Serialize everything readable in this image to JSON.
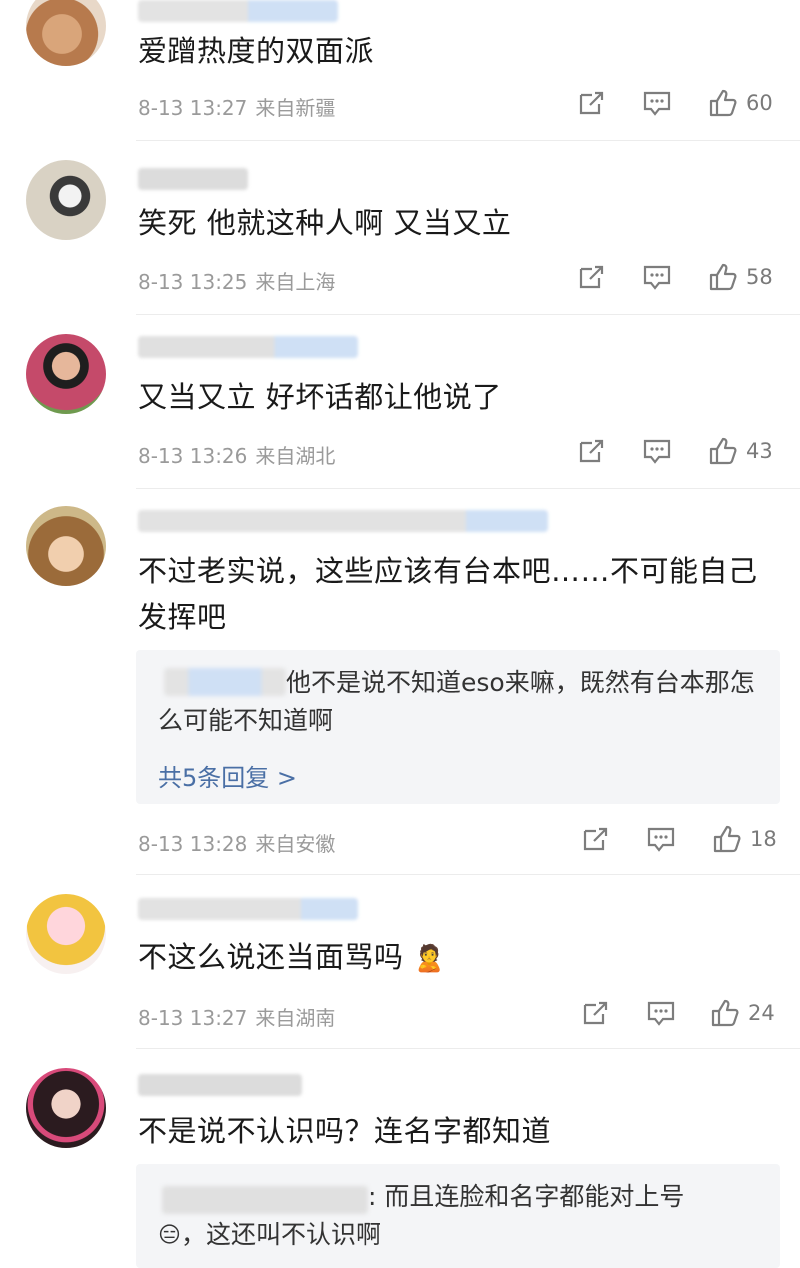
{
  "comments": [
    {
      "text": "爱蹭热度的双面派",
      "time": "8-13 13:27",
      "location": "来自新疆",
      "likes": "60"
    },
    {
      "text": "笑死 他就这种人啊 又当又立",
      "time": "8-13 13:25",
      "location": "来自上海",
      "likes": "58"
    },
    {
      "text": "又当又立 好坏话都让他说了",
      "time": "8-13 13:26",
      "location": "来自湖北",
      "likes": "43"
    },
    {
      "text": "不过老实说，这些应该有台本吧……不可能自己发挥吧",
      "time": "8-13 13:28",
      "location": "来自安徽",
      "likes": "18",
      "reply": {
        "text": "他不是说不知道eso来嘛，既然有台本那怎么可能不知道啊",
        "more": "共5条回复 >"
      }
    },
    {
      "text": "不这么说还当面骂吗",
      "emoji": "🙎",
      "time": "8-13 13:27",
      "location": "来自湖南",
      "likes": "24"
    },
    {
      "text": "不是说不认识吗？连名字都知道",
      "reply": {
        "text": ": 而且连脸和名字都能对上号",
        "text2": "，这还叫不认识啊",
        "emoji": "😑"
      }
    }
  ],
  "icons": {
    "share": "share-icon",
    "comment": "comment-icon",
    "like": "like-icon"
  },
  "colors": {
    "meta": "#9a9a9a",
    "link": "#4a6fa5",
    "reply_bg": "#f4f5f7"
  }
}
